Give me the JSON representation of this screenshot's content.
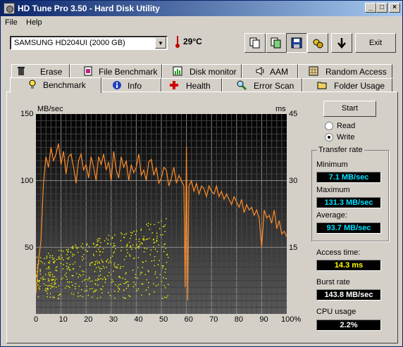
{
  "title": "HD Tune Pro 3.50 - Hard Disk Utility",
  "menu": [
    "File",
    "Help"
  ],
  "drive": "SAMSUNG HD204UI (2000 GB)",
  "temperature": "29°C",
  "exit_label": "Exit",
  "tabs_top": [
    "Erase",
    "File Benchmark",
    "Disk monitor",
    "AAM",
    "Random Access"
  ],
  "tabs_bottom": [
    "Benchmark",
    "Info",
    "Health",
    "Error Scan",
    "Folder Usage"
  ],
  "active_tab": "Benchmark",
  "chart_axes": {
    "left_unit": "MB/sec",
    "right_unit": "ms",
    "left_ticks": [
      "150",
      "100",
      "50"
    ],
    "right_ticks": [
      "45",
      "30",
      "15"
    ],
    "x_ticks": [
      "0",
      "10",
      "20",
      "30",
      "40",
      "50",
      "60",
      "70",
      "80",
      "90",
      "100%"
    ]
  },
  "start_label": "Start",
  "mode_read": "Read",
  "mode_write": "Write",
  "selected_mode": "Write",
  "transfer_rate_label": "Transfer rate",
  "minimum_label": "Minimum",
  "minimum_value": "7.1 MB/sec",
  "maximum_label": "Maximum",
  "maximum_value": "131.3 MB/sec",
  "average_label": "Average:",
  "average_value": "93.7 MB/sec",
  "access_label": "Access time:",
  "access_value": "14.3 ms",
  "burst_label": "Burst rate",
  "burst_value": "143.8 MB/sec",
  "cpu_label": "CPU usage",
  "cpu_value": "2.2%",
  "chart_data": {
    "type": "line",
    "x_unit": "%",
    "ylim": [
      0,
      150
    ],
    "y2lim": [
      0,
      45
    ],
    "grid": true,
    "series": [
      {
        "name": "Transfer rate",
        "axis": "left",
        "color": "#ff8c28",
        "x": [
          0,
          1,
          2,
          3,
          4,
          5,
          6,
          7,
          8,
          9,
          10,
          11,
          12,
          13,
          14,
          15,
          16,
          17,
          18,
          19,
          20,
          21,
          22,
          23,
          24,
          25,
          26,
          27,
          28,
          29,
          30,
          31,
          32,
          33,
          34,
          35,
          36,
          37,
          38,
          39,
          40,
          41,
          42,
          43,
          44,
          45,
          46,
          47,
          48,
          49,
          50,
          51,
          52,
          53,
          54,
          55,
          56,
          57,
          58,
          59,
          59.5,
          60,
          60.5,
          61,
          62,
          63,
          64,
          65,
          66,
          67,
          68,
          69,
          70,
          71,
          72,
          73,
          74,
          75,
          76,
          77,
          78,
          79,
          80,
          81,
          82,
          83,
          84,
          85,
          86,
          87,
          88,
          89,
          90,
          91,
          92,
          93,
          94,
          95,
          96,
          97,
          98,
          99,
          100
        ],
        "values": [
          15,
          40,
          55,
          98,
          118,
          110,
          125,
          115,
          120,
          128,
          112,
          122,
          105,
          118,
          120,
          110,
          98,
          115,
          120,
          108,
          112,
          102,
          118,
          110,
          100,
          118,
          112,
          120,
          108,
          114,
          100,
          122,
          108,
          102,
          118,
          110,
          115,
          100,
          112,
          106,
          110,
          120,
          104,
          108,
          100,
          114,
          116,
          104,
          110,
          98,
          102,
          110,
          108,
          96,
          102,
          110,
          98,
          104,
          100,
          96,
          20,
          125,
          10,
          96,
          100,
          92,
          98,
          90,
          96,
          94,
          88,
          96,
          92,
          90,
          96,
          88,
          92,
          86,
          90,
          86,
          82,
          88,
          84,
          80,
          86,
          76,
          82,
          78,
          80,
          74,
          78,
          72,
          50,
          78,
          72,
          74,
          68,
          78,
          64,
          70,
          60,
          62,
          58
        ]
      },
      {
        "name": "Access time",
        "axis": "right",
        "type": "scatter",
        "color": "#ffff00",
        "range_x": [
          0,
          53
        ],
        "range_y_ms": [
          3,
          22
        ]
      }
    ]
  }
}
